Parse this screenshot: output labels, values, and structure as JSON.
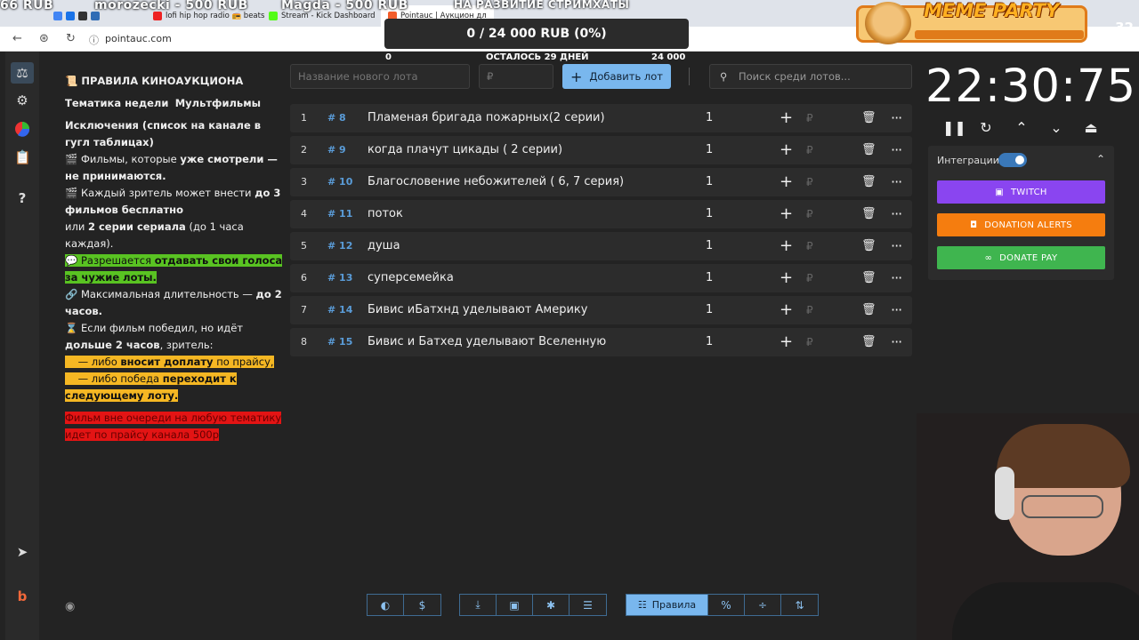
{
  "browser": {
    "tabs": [
      {
        "label": "lofi hip hop radio 📻 beats"
      },
      {
        "label": "Stream - Kick Dashboard"
      },
      {
        "label": "Pointauc | Аукцион дл"
      }
    ],
    "url": "pointauc.com",
    "overlay_donations": [
      "66 RUB",
      "morozecki - 500 RUB",
      "Magda - 500 RUB",
      "НА РАЗВИТИЕ СТРИМХАТЫ"
    ]
  },
  "goal": {
    "text": "0 / 24 000 RUB (0%)",
    "left_label": "0",
    "center_label": "ОСТАЛОСЬ 29 ДНЕЙ",
    "right_label": "24 000"
  },
  "meme_overlay": {
    "title": "MEME PARTY",
    "counter": "32"
  },
  "sidebar": {
    "icons": [
      "gavel-icon",
      "gear-icon",
      "pie-chart-icon",
      "clipboard-icon",
      "help-icon",
      "telegram-icon",
      "brand-icon"
    ]
  },
  "rules": {
    "title": "📜 ПРАВИЛА КИНОАУКЦИОНА",
    "theme_label": "Тематика недели",
    "theme_value": "Мультфильмы",
    "exclusions": "Исключения (список на канале в гугл таблицах)",
    "r1_pre": "🎬 Фильмы, которые ",
    "r1_bold": "уже смотрели — не принимаются.",
    "r2_pre": "🎬 Каждый зритель может внести ",
    "r2_bold1": "до 3 фильмов бесплатно",
    "r2_mid": "или ",
    "r2_bold2": "2 серии сериала",
    "r2_post": " (до 1 часа каждая).",
    "r3_pre": "💬 Разрешается ",
    "r3_bold": "отдавать свои голоса за чужие лоты.",
    "r4_pre": "🔗 Максимальная длительность — ",
    "r4_bold": "до 2 часов.",
    "r5_pre": "⌛ Если фильм победил, но идёт ",
    "r5_bold": "дольше 2 часов",
    "r5_post": ", зритель:",
    "r5_opt1_pre": "— либо ",
    "r5_opt1_bold": "вносит доплату",
    "r5_opt1_post": " по прайсу,",
    "r5_opt2_pre": "— либо победа ",
    "r5_opt2_bold": "переходит к следующему лоту.",
    "r6": "Фильм вне очереди на любую тематику идет по прайсу канала 500р"
  },
  "controls": {
    "lot_name_placeholder": "Название нового лота",
    "amount_placeholder": "₽",
    "add_button": "Добавить лот",
    "search_placeholder": "Поиск среди лотов..."
  },
  "lots": [
    {
      "index": "1",
      "id": "8",
      "name": "Пламеная бригада пожарных(2 серии)",
      "amount": "1"
    },
    {
      "index": "2",
      "id": "9",
      "name": "когда плачут цикады ( 2 серии)",
      "amount": "1"
    },
    {
      "index": "3",
      "id": "10",
      "name": " Благословение небожителей ( 6, 7 серия)",
      "amount": "1"
    },
    {
      "index": "4",
      "id": "11",
      "name": "поток",
      "amount": "1"
    },
    {
      "index": "5",
      "id": "12",
      "name": "душа",
      "amount": "1"
    },
    {
      "index": "6",
      "id": "13",
      "name": "суперсемейка",
      "amount": "1"
    },
    {
      "index": "7",
      "id": "14",
      "name": "Бивис иБатхнд уделывают Америку",
      "amount": "1"
    },
    {
      "index": "8",
      "id": "15",
      "name": "Бивис и Батхед уделывают Вселенную",
      "amount": "1"
    }
  ],
  "timer": "22:30:75",
  "integrations": {
    "label": "Интеграции",
    "enabled": true,
    "buttons": [
      {
        "label": "TWITCH",
        "color": "#8a45f0"
      },
      {
        "label": "DONATION ALERTS",
        "color": "#f57d0f"
      },
      {
        "label": "DONATE PAY",
        "color": "#3fb54f"
      }
    ]
  },
  "bottom_toolbar": {
    "rules_label": "Правила"
  },
  "colors": {
    "accent": "#79b7ee",
    "bg": "#232323",
    "panel": "#2c2c2c"
  }
}
